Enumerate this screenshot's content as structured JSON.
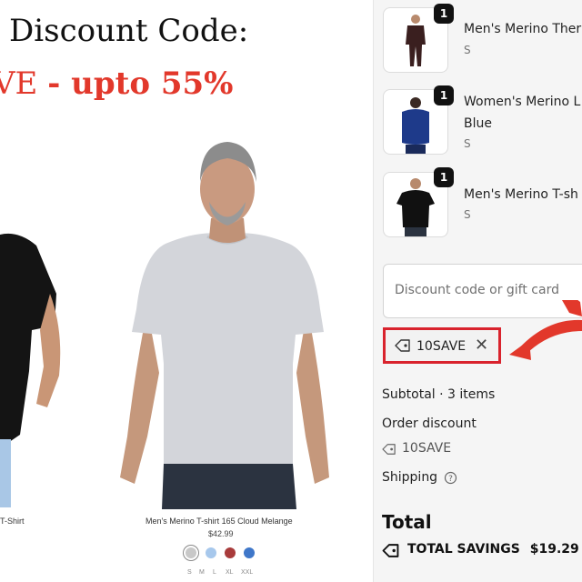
{
  "promo": {
    "title": "Discount Code:",
    "code_part": "VE",
    "discount_part": "- upto 55%"
  },
  "products": [
    {
      "name": "T-Shirt"
    },
    {
      "name": "Men's Merino T-shirt 165 Cloud Melange",
      "price": "$42.99",
      "swatches": [
        "#c8c8c8",
        "#a7c8ec",
        "#a83b3b",
        "#3f77c9"
      ],
      "sizes": [
        "S",
        "M",
        "L",
        "XL",
        "XXL"
      ]
    }
  ],
  "cart": {
    "items": [
      {
        "qty": "1",
        "name": "Men's Merino Ther",
        "variant": "S"
      },
      {
        "qty": "1",
        "name": "Women's Merino L",
        "name2": "Blue",
        "variant": "S"
      },
      {
        "qty": "1",
        "name": "Men's Merino T-sh",
        "variant": "S"
      }
    ],
    "discount_placeholder": "Discount code or gift card",
    "applied_code": "10SAVE",
    "subtotal_label": "Subtotal · 3 items",
    "order_discount_label": "Order discount",
    "order_discount_code": "10SAVE",
    "shipping_label": "Shipping",
    "total_label": "Total",
    "savings_label": "TOTAL SAVINGS",
    "savings_value": "$19.29"
  },
  "colors": {
    "accent_red": "#e2382b",
    "chip_border": "#d9232d"
  }
}
